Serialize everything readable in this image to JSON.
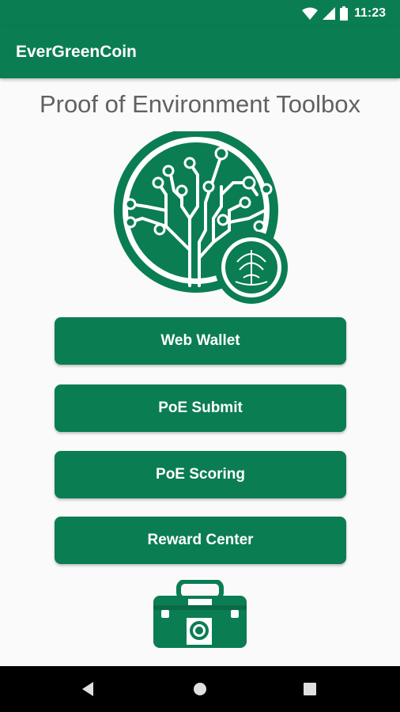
{
  "status_bar": {
    "time": "11:23",
    "icons": [
      "wifi-icon",
      "signal-icon",
      "battery-icon"
    ]
  },
  "app_bar": {
    "title": "EverGreenCoin"
  },
  "main": {
    "title": "Proof of Environment Toolbox",
    "buttons": [
      {
        "label": "Web Wallet"
      },
      {
        "label": "PoE Submit"
      },
      {
        "label": "PoE Scoring"
      },
      {
        "label": "Reward Center"
      }
    ]
  },
  "nav_bar": {
    "icons": [
      "back-icon",
      "home-icon",
      "recents-icon"
    ]
  },
  "colors": {
    "brand_green": "#0b7d52",
    "background": "#fafafa",
    "title_gray": "#616161"
  }
}
